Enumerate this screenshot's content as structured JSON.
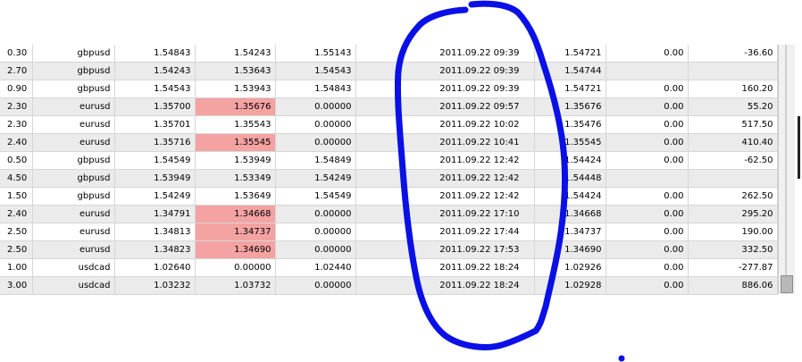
{
  "rows": [
    {
      "lots": "0.30",
      "symbol": "gbpusd",
      "open": "1.54843",
      "sl": "1.54243",
      "tp": "1.55143",
      "close_time": "2011.09.22 09:39",
      "close": "1.54721",
      "swap": "0.00",
      "profit": "-36.60",
      "sl_hit": false,
      "alt": false
    },
    {
      "lots": "2.70",
      "symbol": "gbpusd",
      "open": "1.54243",
      "sl": "1.53643",
      "tp": "1.54543",
      "close_time": "2011.09.22 09:39",
      "close": "1.54744",
      "swap": "",
      "profit": "",
      "sl_hit": false,
      "alt": true
    },
    {
      "lots": "0.90",
      "symbol": "gbpusd",
      "open": "1.54543",
      "sl": "1.53943",
      "tp": "1.54843",
      "close_time": "2011.09.22 09:39",
      "close": "1.54721",
      "swap": "0.00",
      "profit": "160.20",
      "sl_hit": false,
      "alt": false
    },
    {
      "lots": "2.30",
      "symbol": "eurusd",
      "open": "1.35700",
      "sl": "1.35676",
      "tp": "0.00000",
      "close_time": "2011.09.22 09:57",
      "close": "1.35676",
      "swap": "0.00",
      "profit": "55.20",
      "sl_hit": true,
      "alt": true
    },
    {
      "lots": "2.30",
      "symbol": "eurusd",
      "open": "1.35701",
      "sl": "1.35543",
      "tp": "0.00000",
      "close_time": "2011.09.22 10:02",
      "close": "1.35476",
      "swap": "0.00",
      "profit": "517.50",
      "sl_hit": false,
      "alt": false
    },
    {
      "lots": "2.40",
      "symbol": "eurusd",
      "open": "1.35716",
      "sl": "1.35545",
      "tp": "0.00000",
      "close_time": "2011.09.22 10:41",
      "close": "1.35545",
      "swap": "0.00",
      "profit": "410.40",
      "sl_hit": true,
      "alt": true
    },
    {
      "lots": "0.50",
      "symbol": "gbpusd",
      "open": "1.54549",
      "sl": "1.53949",
      "tp": "1.54849",
      "close_time": "2011.09.22 12:42",
      "close": "1.54424",
      "swap": "0.00",
      "profit": "-62.50",
      "sl_hit": false,
      "alt": false
    },
    {
      "lots": "4.50",
      "symbol": "gbpusd",
      "open": "1.53949",
      "sl": "1.53349",
      "tp": "1.54249",
      "close_time": "2011.09.22 12:42",
      "close": "1.54448",
      "swap": "",
      "profit": "",
      "sl_hit": false,
      "alt": true
    },
    {
      "lots": "1.50",
      "symbol": "gbpusd",
      "open": "1.54249",
      "sl": "1.53649",
      "tp": "1.54549",
      "close_time": "2011.09.22 12:42",
      "close": "1.54424",
      "swap": "0.00",
      "profit": "262.50",
      "sl_hit": false,
      "alt": false
    },
    {
      "lots": "2.40",
      "symbol": "eurusd",
      "open": "1.34791",
      "sl": "1.34668",
      "tp": "0.00000",
      "close_time": "2011.09.22 17:10",
      "close": "1.34668",
      "swap": "0.00",
      "profit": "295.20",
      "sl_hit": true,
      "alt": true
    },
    {
      "lots": "2.50",
      "symbol": "eurusd",
      "open": "1.34813",
      "sl": "1.34737",
      "tp": "0.00000",
      "close_time": "2011.09.22 17:44",
      "close": "1.34737",
      "swap": "0.00",
      "profit": "190.00",
      "sl_hit": true,
      "alt": false
    },
    {
      "lots": "2.50",
      "symbol": "eurusd",
      "open": "1.34823",
      "sl": "1.34690",
      "tp": "0.00000",
      "close_time": "2011.09.22 17:53",
      "close": "1.34690",
      "swap": "0.00",
      "profit": "332.50",
      "sl_hit": true,
      "alt": true
    },
    {
      "lots": "1.00",
      "symbol": "usdcad",
      "open": "1.02640",
      "sl": "0.00000",
      "tp": "1.02440",
      "close_time": "2011.09.22 18:24",
      "close": "1.02926",
      "swap": "0.00",
      "profit": "-277.87",
      "sl_hit": false,
      "alt": false
    },
    {
      "lots": "3.00",
      "symbol": "usdcad",
      "open": "1.03232",
      "sl": "1.03732",
      "tp": "0.00000",
      "close_time": "2011.09.22 18:24",
      "close": "1.02928",
      "swap": "0.00",
      "profit": "886.06",
      "sl_hit": false,
      "alt": true
    }
  ],
  "colors": {
    "sl_highlight": "#f4a2a2",
    "alt_row": "#ebebeb",
    "annotation": "#0a10e6"
  }
}
